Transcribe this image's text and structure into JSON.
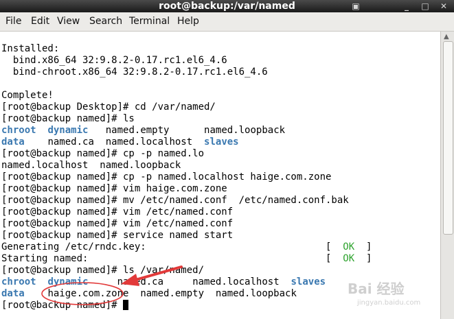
{
  "window": {
    "title": "root@backup:/var/named"
  },
  "menu": [
    "File",
    "Edit",
    "View",
    "Search",
    "Terminal",
    "Help"
  ],
  "terminal": {
    "installed_header": "Installed:",
    "installed_1": "  bind.x86_64 32:9.8.2-0.17.rc1.el6_4.6",
    "installed_2": "  bind-chroot.x86_64 32:9.8.2-0.17.rc1.el6_4.6",
    "complete": "Complete!",
    "cmd_cd": "[root@backup Desktop]# cd /var/named/",
    "cmd_ls": "[root@backup named]# ls",
    "ls1": {
      "chroot": "chroot",
      "dynamic": "dynamic",
      "named_empty": "named.empty",
      "named_loopback": "named.loopback"
    },
    "ls2": {
      "data": "data",
      "named_ca": "named.ca",
      "named_localhost": "named.localhost",
      "slaves": "slaves"
    },
    "cmd_cp1": "[root@backup named]# cp -p named.lo",
    "complete_list": "named.localhost  named.loopback",
    "cmd_cp2": "[root@backup named]# cp -p named.localhost haige.com.zone",
    "cmd_vim1": "[root@backup named]# vim haige.com.zone",
    "cmd_mv": "[root@backup named]# mv /etc/named.conf  /etc/named.conf.bak",
    "cmd_vim2": "[root@backup named]# vim /etc/named.conf",
    "cmd_vim3": "[root@backup named]# vim /etc/named.conf",
    "cmd_service": "[root@backup named]# service named start",
    "gen_rndc": "Generating /etc/rndc.key:",
    "start_named": "Starting named:",
    "ok_label": "OK",
    "cmd_ls2": "[root@backup named]# ls /var/named/",
    "ls3": {
      "chroot": "chroot",
      "dynamic": "dynamic",
      "named_ca": "named.ca",
      "named_localhost": "named.localhost",
      "slaves": "slaves"
    },
    "ls4": {
      "data": "data",
      "haige_zone": "haige.com.zone",
      "named_empty": "named.empty",
      "named_loopback": "named.loopback"
    },
    "prompt": "[root@backup named]# "
  },
  "watermark": {
    "brand": "Bai 经验",
    "url": "jingyan.baidu.com"
  },
  "colors": {
    "directory": "#3a78b0",
    "ok": "#2ea32e",
    "annotation": "#e23a3a"
  }
}
